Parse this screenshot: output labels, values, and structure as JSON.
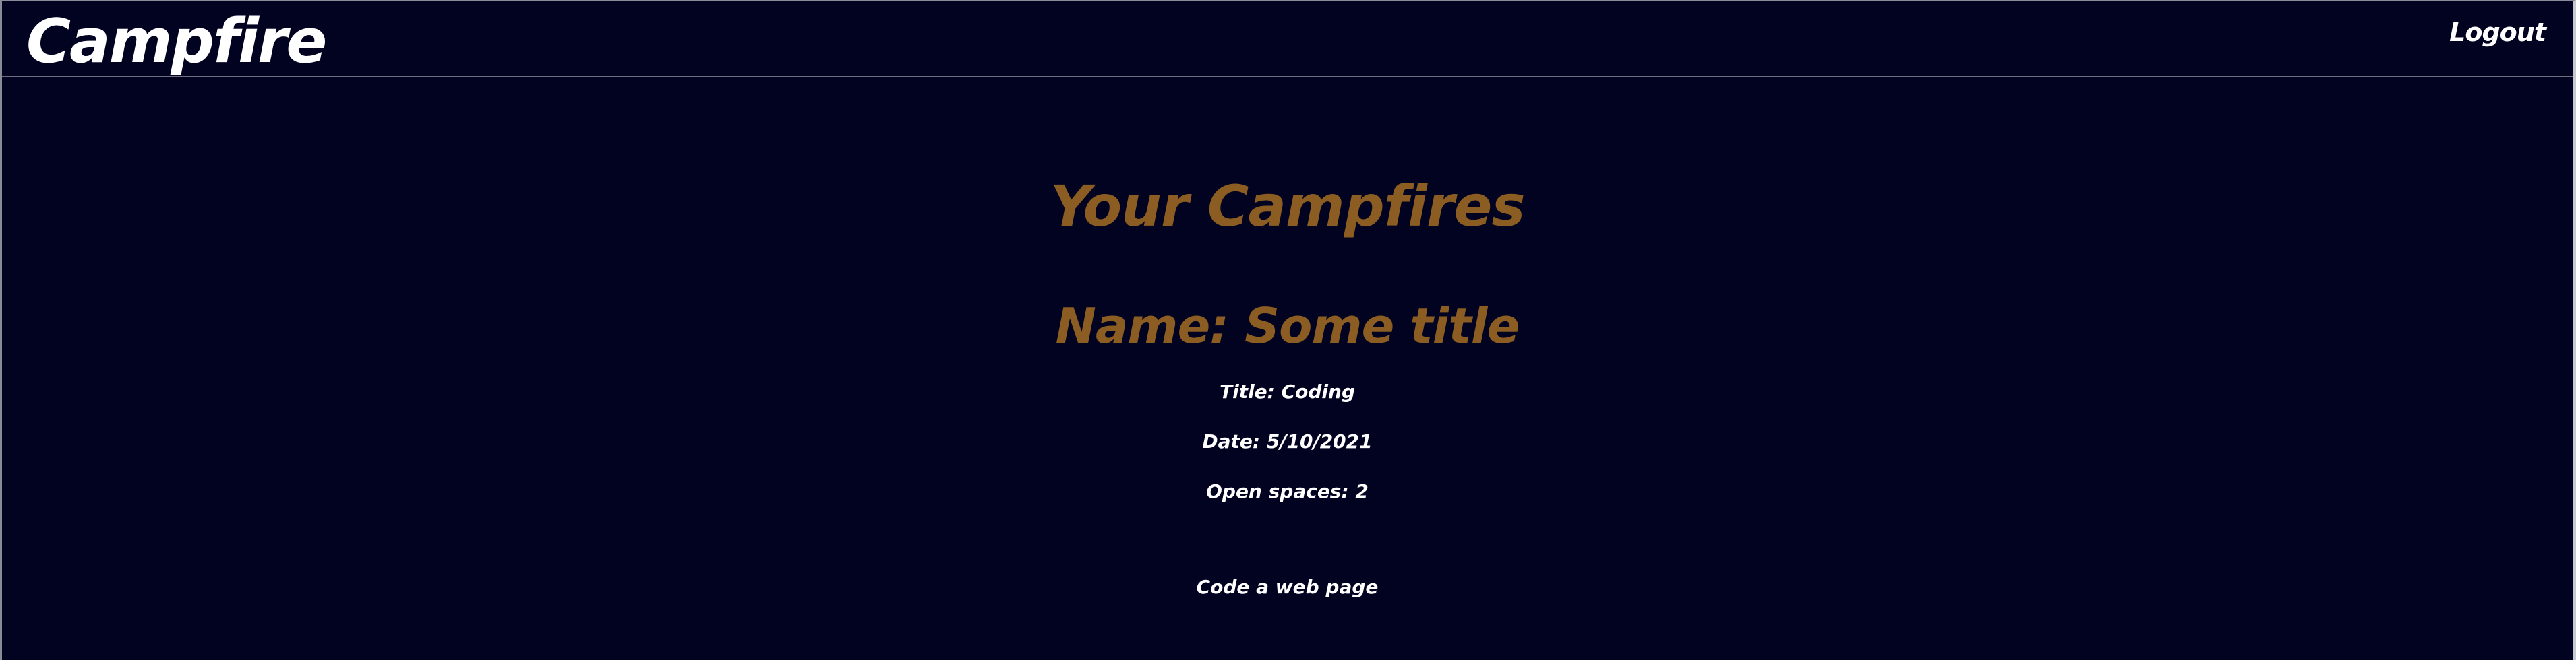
{
  "navbar": {
    "brand": "Campfire",
    "logout_label": "Logout"
  },
  "main": {
    "heading": "Your Campfires",
    "campfire": {
      "name": "Name: Some title",
      "title": "Title: Coding",
      "date": "Date: 5/10/2021",
      "open_spaces": "Open spaces: 2",
      "description": "Code a web page"
    }
  },
  "colors": {
    "background": "#020221",
    "accent": "#8b5d22",
    "text": "#ffffff"
  }
}
